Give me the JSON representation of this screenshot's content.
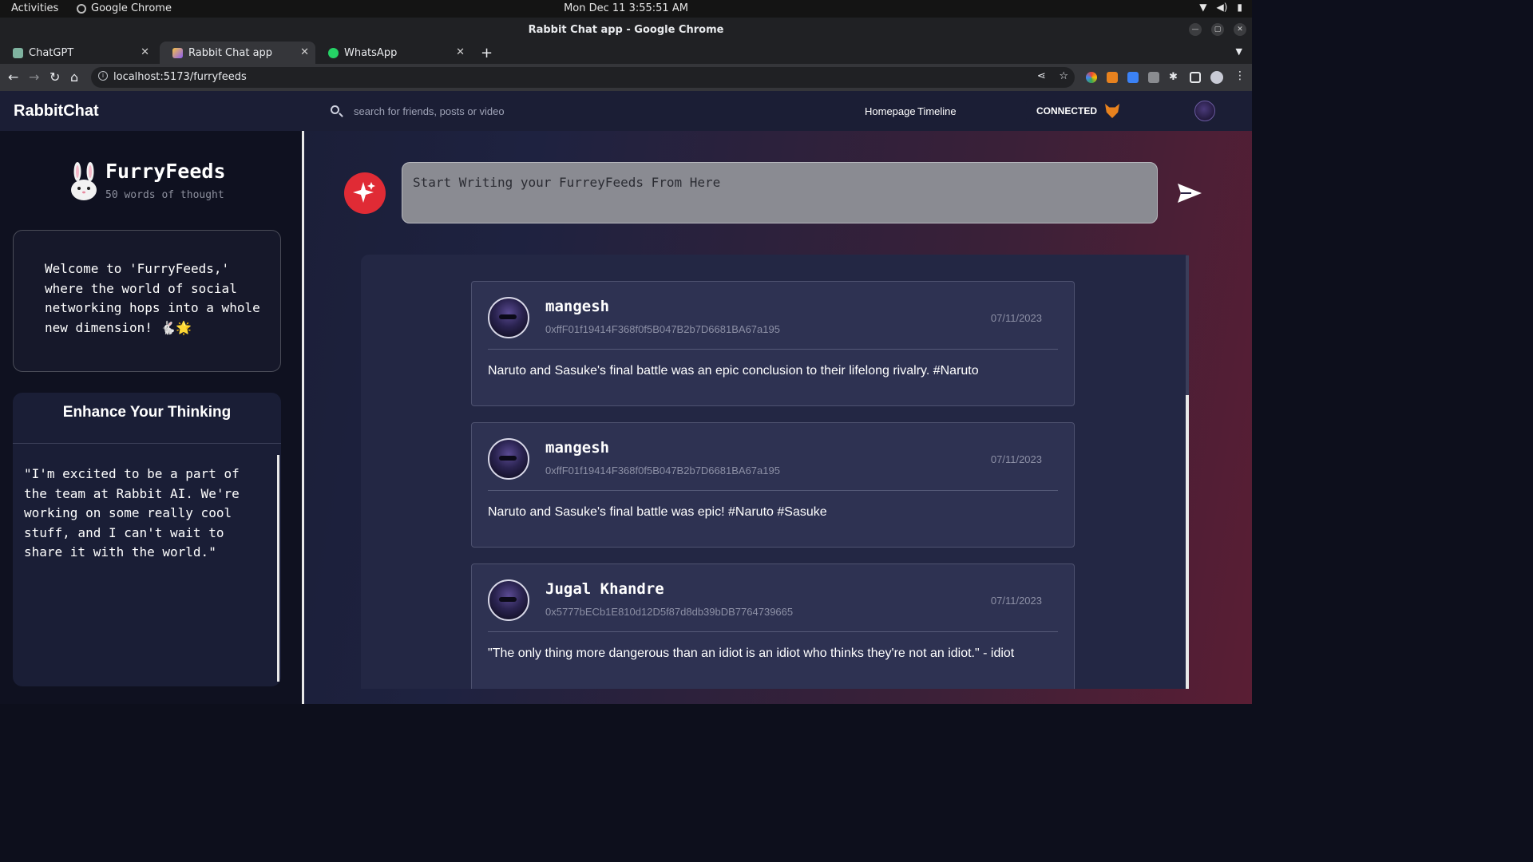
{
  "os": {
    "activities": "Activities",
    "app_name": "Google Chrome",
    "clock": "Mon Dec 11  3:55:51 AM"
  },
  "window": {
    "title": "Rabbit Chat app - Google Chrome"
  },
  "tabs": [
    {
      "label": "ChatGPT"
    },
    {
      "label": "Rabbit Chat app"
    },
    {
      "label": "WhatsApp"
    }
  ],
  "address": {
    "url": "localhost:5173/furryfeeds"
  },
  "navbar": {
    "brand": "RabbitChat",
    "search_placeholder": "search for friends, posts or video",
    "links": [
      "Homepage",
      "Timeline"
    ],
    "connected_label": "CONNECTED"
  },
  "sidebar": {
    "title": "FurryFeeds",
    "subtitle": "50 words of thought",
    "welcome": "Welcome to 'FurryFeeds,' where the world of social networking hops into a whole new dimension! 🐇🌟",
    "enhance_title": "Enhance Your Thinking",
    "quote": "\"I'm excited to be a part of the team at Rabbit AI. We're working on some really cool stuff, and I can't wait to share it with the world.\""
  },
  "composer": {
    "placeholder": "Start Writing your FurreyFeeds From Here"
  },
  "posts": [
    {
      "name": "mangesh",
      "address": "0xffF01f19414F368f0f5B047B2b7D6681BA67a195",
      "date": "07/11/2023",
      "content": "Naruto and Sasuke's final battle was an epic conclusion to their lifelong rivalry. #Naruto"
    },
    {
      "name": "mangesh",
      "address": "0xffF01f19414F368f0f5B047B2b7D6681BA67a195",
      "date": "07/11/2023",
      "content": "Naruto and Sasuke's final battle was epic! #Naruto #Sasuke"
    },
    {
      "name": "Jugal Khandre",
      "address": "0x5777bECb1E810d12D5f87d8db39bDB7764739665",
      "date": "07/11/2023",
      "content": "\"The only thing more dangerous than an idiot is an idiot who thinks they're not an idiot.\" - idiot"
    }
  ],
  "colors": {
    "accent_red": "#e02b35",
    "navbar_bg": "#1b1e35",
    "sidebar_bg": "#0f1120",
    "card_bg": "#2e3252"
  },
  "icons": [
    "search-icon",
    "metamask-fox-icon",
    "rabbit-icon",
    "sparkle-icon",
    "send-icon"
  ]
}
